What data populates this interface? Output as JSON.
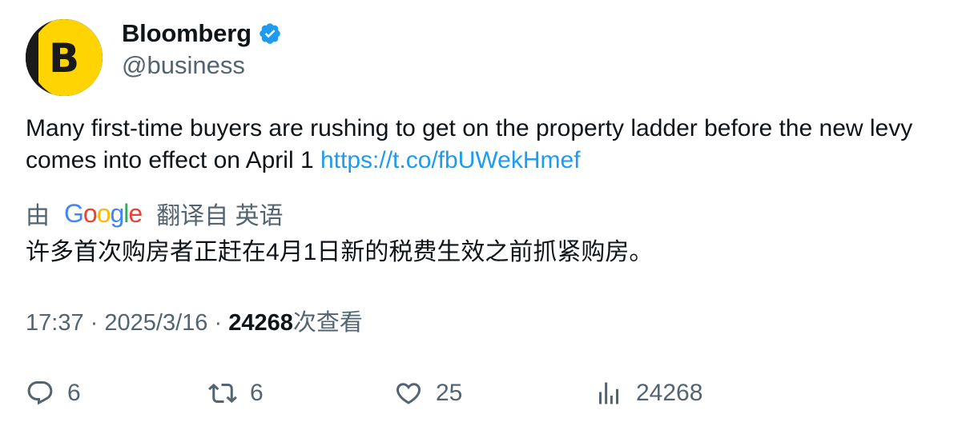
{
  "author": {
    "display_name": "Bloomberg",
    "handle": "@business",
    "avatar_letter": "B",
    "verified": true
  },
  "tweet": {
    "text": "Many first-time buyers are rushing to get on the property ladder before the new levy comes into effect on April 1 ",
    "link": "https://t.co/fbUWekHmef"
  },
  "translation": {
    "prefix": "由",
    "provider_letters": [
      "G",
      "o",
      "o",
      "g",
      "l",
      "e"
    ],
    "suffix": "翻译自 英语",
    "text": "许多首次购房者正赶在4月1日新的税费生效之前抓紧购房。"
  },
  "meta": {
    "time": "17:37",
    "separator": "·",
    "date": "2025/3/16",
    "views_count": "24268",
    "views_label": "次查看"
  },
  "actions": {
    "replies": "6",
    "retweets": "6",
    "likes": "25",
    "views": "24268"
  },
  "colors": {
    "accent": "#1d9bf0",
    "secondary_text": "#536471",
    "primary_text": "#0f1419",
    "avatar_yellow": "#ffd400",
    "google": [
      "#4285F4",
      "#EA4335",
      "#FBBC05",
      "#4285F4",
      "#34A853",
      "#EA4335"
    ]
  }
}
